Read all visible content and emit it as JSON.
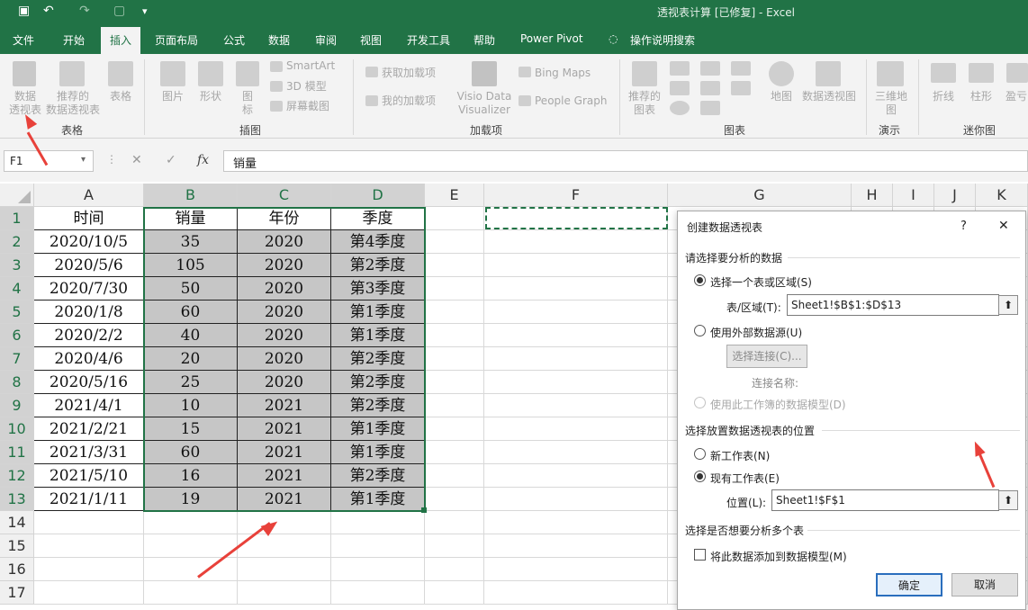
{
  "window": {
    "title": "透视表计算 [已修复] - Excel"
  },
  "tabs": [
    "文件",
    "开始",
    "插入",
    "页面布局",
    "公式",
    "数据",
    "审阅",
    "视图",
    "开发工具",
    "帮助",
    "Power Pivot",
    "操作说明搜索"
  ],
  "ribbon": {
    "pivot_table": "数据\n透视表",
    "recommended_pivot": "推荐的\n数据透视表",
    "table": "表格",
    "group_tables": "表格",
    "picture": "图片",
    "shapes": "形状",
    "icons": "图\n标",
    "smartart": "SmartArt",
    "model3d": "3D 模型",
    "screenshot": "屏幕截图",
    "group_illustrations": "插图",
    "get_addins": "获取加载项",
    "my_addins": "我的加载项",
    "visio": "Visio Data\nVisualizer",
    "bing_maps": "Bing Maps",
    "people_graph": "People Graph",
    "group_addins": "加载项",
    "recommended_charts": "推荐的\n图表",
    "maps": "地图",
    "pivot_chart": "数据透视图",
    "group_charts": "图表",
    "map3d": "三维地\n图",
    "group_tours": "演示",
    "line": "折线",
    "column": "柱形",
    "winloss": "盈亏",
    "group_sparklines": "迷你图"
  },
  "formula_bar": {
    "name_box": "F1",
    "cancel": "✕",
    "enter": "✓",
    "fx": "fx",
    "content": "销量"
  },
  "columns": [
    "A",
    "B",
    "C",
    "D",
    "E",
    "F",
    "G",
    "H",
    "I",
    "J",
    "K"
  ],
  "rows": [
    "1",
    "2",
    "3",
    "4",
    "5",
    "6",
    "7",
    "8",
    "9",
    "10",
    "11",
    "12",
    "13",
    "14",
    "15",
    "16",
    "17"
  ],
  "table": [
    [
      "时间",
      "销量",
      "年份",
      "季度"
    ],
    [
      "2020/10/5",
      "35",
      "2020",
      "第4季度"
    ],
    [
      "2020/5/6",
      "105",
      "2020",
      "第2季度"
    ],
    [
      "2020/7/30",
      "50",
      "2020",
      "第3季度"
    ],
    [
      "2020/1/8",
      "60",
      "2020",
      "第1季度"
    ],
    [
      "2020/2/2",
      "40",
      "2020",
      "第1季度"
    ],
    [
      "2020/4/6",
      "20",
      "2020",
      "第2季度"
    ],
    [
      "2020/5/16",
      "25",
      "2020",
      "第2季度"
    ],
    [
      "2021/4/1",
      "10",
      "2021",
      "第2季度"
    ],
    [
      "2021/2/21",
      "15",
      "2021",
      "第1季度"
    ],
    [
      "2021/3/31",
      "60",
      "2021",
      "第1季度"
    ],
    [
      "2021/5/10",
      "16",
      "2021",
      "第2季度"
    ],
    [
      "2021/1/11",
      "19",
      "2021",
      "第1季度"
    ]
  ],
  "dialog": {
    "title": "创建数据透视表",
    "help": "?",
    "close": "✕",
    "section1": "请选择要分析的数据",
    "opt_range": "选择一个表或区域(S)",
    "range_label": "表/区域(T):",
    "range_value": "Sheet1!$B$1:$D$13",
    "opt_external": "使用外部数据源(U)",
    "choose_conn": "选择连接(C)...",
    "conn_name": "连接名称:",
    "opt_model": "使用此工作簿的数据模型(D)",
    "section2": "选择放置数据透视表的位置",
    "opt_new": "新工作表(N)",
    "opt_existing": "现有工作表(E)",
    "location_label": "位置(L):",
    "location_value": "Sheet1!$F$1",
    "section3": "选择是否想要分析多个表",
    "add_model": "将此数据添加到数据模型(M)",
    "ok": "确定",
    "cancel": "取消",
    "collapse_icon": "⬆"
  }
}
